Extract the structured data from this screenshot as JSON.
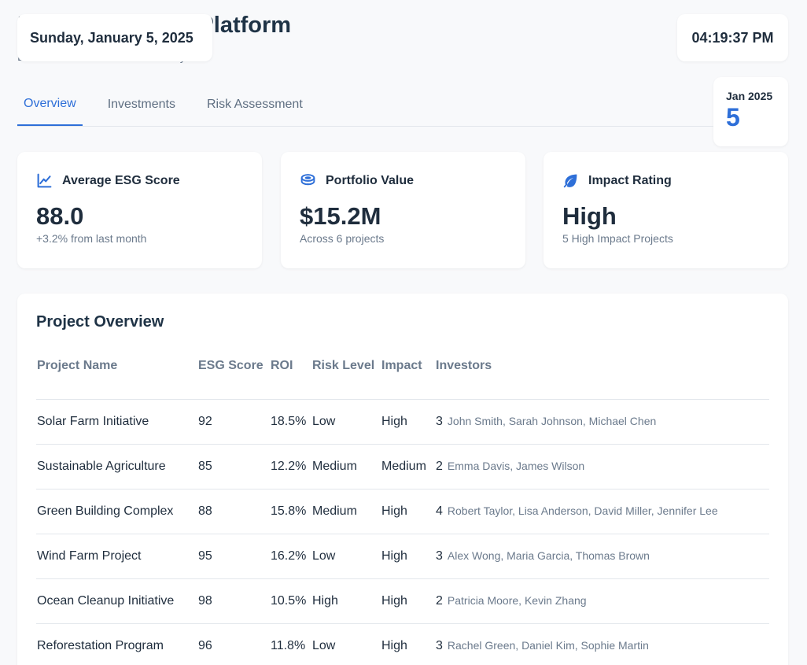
{
  "header": {
    "title": "ESG Investment Platform",
    "subtitle": "Environmental Investment Analysis",
    "date": "Sunday, January 5, 2025",
    "time": "04:19:37 PM",
    "calendar": {
      "month": "Jan 2025",
      "day": "5"
    }
  },
  "tabs": [
    {
      "label": "Overview",
      "active": true
    },
    {
      "label": "Investments",
      "active": false
    },
    {
      "label": "Risk Assessment",
      "active": false
    }
  ],
  "stats": [
    {
      "icon": "trend-line-icon",
      "label": "Average ESG Score",
      "value": "88.0",
      "sub": "+3.2% from last month"
    },
    {
      "icon": "coins-icon",
      "label": "Portfolio Value",
      "value": "$15.2M",
      "sub": "Across 6 projects"
    },
    {
      "icon": "leaf-icon",
      "label": "Impact Rating",
      "value": "High",
      "sub": "5 High Impact Projects"
    }
  ],
  "overview": {
    "title": "Project Overview",
    "columns": [
      "Project Name",
      "ESG Score",
      "ROI",
      "Risk Level",
      "Impact",
      "Investors"
    ],
    "rows": [
      {
        "name": "Solar Farm Initiative",
        "esg": "92",
        "roi": "18.5%",
        "risk": "Low",
        "impact": "High",
        "count": "3",
        "investors": "John Smith, Sarah Johnson, Michael Chen"
      },
      {
        "name": "Sustainable Agriculture",
        "esg": "85",
        "roi": "12.2%",
        "risk": "Medium",
        "impact": "Medium",
        "count": "2",
        "investors": "Emma Davis, James Wilson"
      },
      {
        "name": "Green Building Complex",
        "esg": "88",
        "roi": "15.8%",
        "risk": "Medium",
        "impact": "High",
        "count": "4",
        "investors": "Robert Taylor, Lisa Anderson, David Miller, Jennifer Lee"
      },
      {
        "name": "Wind Farm Project",
        "esg": "95",
        "roi": "16.2%",
        "risk": "Low",
        "impact": "High",
        "count": "3",
        "investors": "Alex Wong, Maria Garcia, Thomas Brown"
      },
      {
        "name": "Ocean Cleanup Initiative",
        "esg": "98",
        "roi": "10.5%",
        "risk": "High",
        "impact": "High",
        "count": "2",
        "investors": "Patricia Moore, Kevin Zhang"
      },
      {
        "name": "Reforestation Program",
        "esg": "96",
        "roi": "11.8%",
        "risk": "Low",
        "impact": "High",
        "count": "3",
        "investors": "Rachel Green, Daniel Kim, Sophie Martin"
      }
    ]
  },
  "colors": {
    "accent": "#2e6fd8",
    "text": "#1f2d3d",
    "muted": "#6b7a8c",
    "background": "#f8f9fb"
  }
}
